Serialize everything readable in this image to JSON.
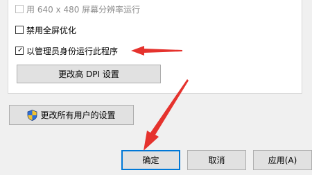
{
  "options": {
    "resolution_640": {
      "label": "用 640 x 480 屏幕分辨率运行",
      "checked": false,
      "enabled": false
    },
    "disable_fullscreen_opt": {
      "label": "禁用全屏优化",
      "checked": false,
      "enabled": true
    },
    "run_as_admin": {
      "label": "以管理员身份运行此程序",
      "checked": true,
      "enabled": true
    }
  },
  "buttons": {
    "change_dpi": "更改高 DPI 设置",
    "change_all_users": "更改所有用户的设置",
    "ok": "确定",
    "cancel": "取消",
    "apply": "应用(A)"
  },
  "annotation": {
    "arrow_color": "#e5322d"
  },
  "icons": {
    "uac_shield": "uac-shield-icon",
    "checkmark": "checkmark-icon"
  }
}
